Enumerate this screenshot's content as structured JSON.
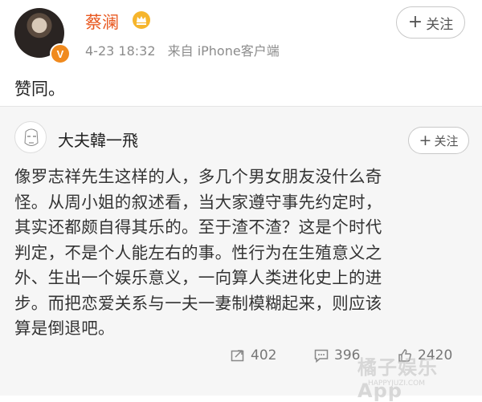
{
  "post": {
    "author": "蔡澜",
    "timestamp": "4-23 18:32",
    "source": "来自 iPhone客户端",
    "follow_label": "关注",
    "follow_icon": "plus-icon",
    "content": "赞同。",
    "verified_badge": "V",
    "accent_color": "#e8571e",
    "badge_color": "#f08a1e"
  },
  "repost": {
    "author": "大夫韓一飛",
    "follow_label": "关注",
    "lines": [
      "像罗志祥先生这样的人，多几个男女朋友没什么奇",
      "怪。从周小姐的叙述看，当大家遵守事先约定时，",
      "其实还都颇自得其乐的。至于渣不渣？这是个时代",
      "判定，不是个人能左右的事。性行为在生殖意义之",
      "外、生出一个娱乐意义，一向算人类进化史上的进",
      "步。而把恋爱关系与一夫一妻制模糊起来，则应该",
      "算是倒退吧。"
    ],
    "actions": {
      "repost_count": "402",
      "comment_count": "396",
      "like_count": "2420"
    }
  },
  "watermark": {
    "text": "橘子娱乐App",
    "sub": "HAPPYJUZI.COM"
  }
}
